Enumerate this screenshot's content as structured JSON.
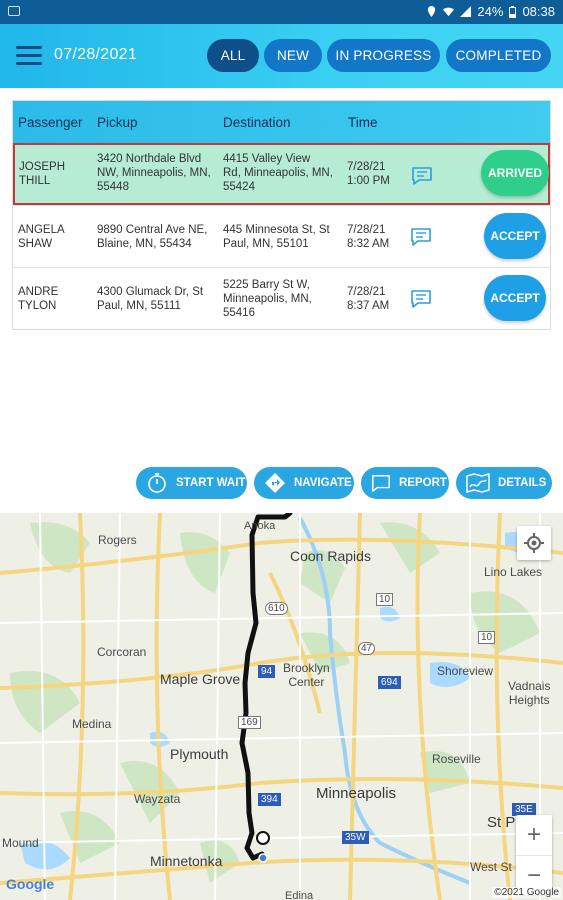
{
  "status_bar": {
    "battery": "24%",
    "time": "08:38"
  },
  "header": {
    "date": "07/28/2021",
    "filters": [
      {
        "label": "ALL",
        "active": true
      },
      {
        "label": "NEW",
        "active": false
      },
      {
        "label": "IN PROGRESS",
        "active": false
      },
      {
        "label": "COMPLETED",
        "active": false
      }
    ]
  },
  "table": {
    "columns": [
      "Passenger",
      "Pickup",
      "Destination",
      "Time"
    ],
    "rows": [
      {
        "passenger": [
          "JOSEPH",
          "THILL"
        ],
        "pickup": [
          "3420 Northdale Blvd",
          "NW, Minneapolis, MN,",
          "55448"
        ],
        "destination": [
          "4415 Valley View",
          "Rd, Minneapolis, MN,",
          "55424"
        ],
        "time": [
          "7/28/21",
          "1:00 PM"
        ],
        "action": "ARRIVED",
        "selected": true
      },
      {
        "passenger": [
          "ANGELA",
          "SHAW"
        ],
        "pickup": [
          "9890 Central Ave NE,",
          "Blaine, MN, 55434"
        ],
        "destination": [
          "445 Minnesota St, St",
          "Paul, MN, 55101"
        ],
        "time": [
          "7/28/21",
          "8:32 AM"
        ],
        "action": "ACCEPT",
        "selected": false
      },
      {
        "passenger": [
          "ANDRE",
          "TYLON"
        ],
        "pickup": [
          "4300 Glumack Dr, St",
          "Paul, MN, 55111"
        ],
        "destination": [
          "5225 Barry St W,",
          "Minneapolis, MN,",
          "55416"
        ],
        "time": [
          "7/28/21",
          "8:37 AM"
        ],
        "action": "ACCEPT",
        "selected": false
      }
    ]
  },
  "toolbar": {
    "start_wait": "START WAIT",
    "navigate": "NAVIGATE",
    "report": "REPORT",
    "details": "DETAILS"
  },
  "map": {
    "labels": {
      "anoka": "Anoka",
      "rogers": "Rogers",
      "coon_rapids": "Coon Rapids",
      "lino_lakes": "Lino Lakes",
      "corcoran": "Corcoran",
      "maple_grove": "Maple Grove",
      "brooklyn_center": [
        "Brooklyn",
        "Center"
      ],
      "shoreview": "Shoreview",
      "vadnais_heights": [
        "Vadnais",
        "Heights"
      ],
      "medina": "Medina",
      "plymouth": "Plymouth",
      "roseville": "Roseville",
      "wayzata": "Wayzata",
      "minneapolis": "Minneapolis",
      "st_paul": "St Pa",
      "mound": "Mound",
      "minnetonka": "Minnetonka",
      "west_st_p": "West St P",
      "edina": "Edina"
    },
    "highways": [
      "10",
      "610",
      "10",
      "47",
      "94",
      "694",
      "169",
      "394",
      "35W",
      "35E"
    ],
    "google": "Google",
    "copyright": "©2021 Google",
    "zoom_in": "+",
    "zoom_out": "−"
  }
}
